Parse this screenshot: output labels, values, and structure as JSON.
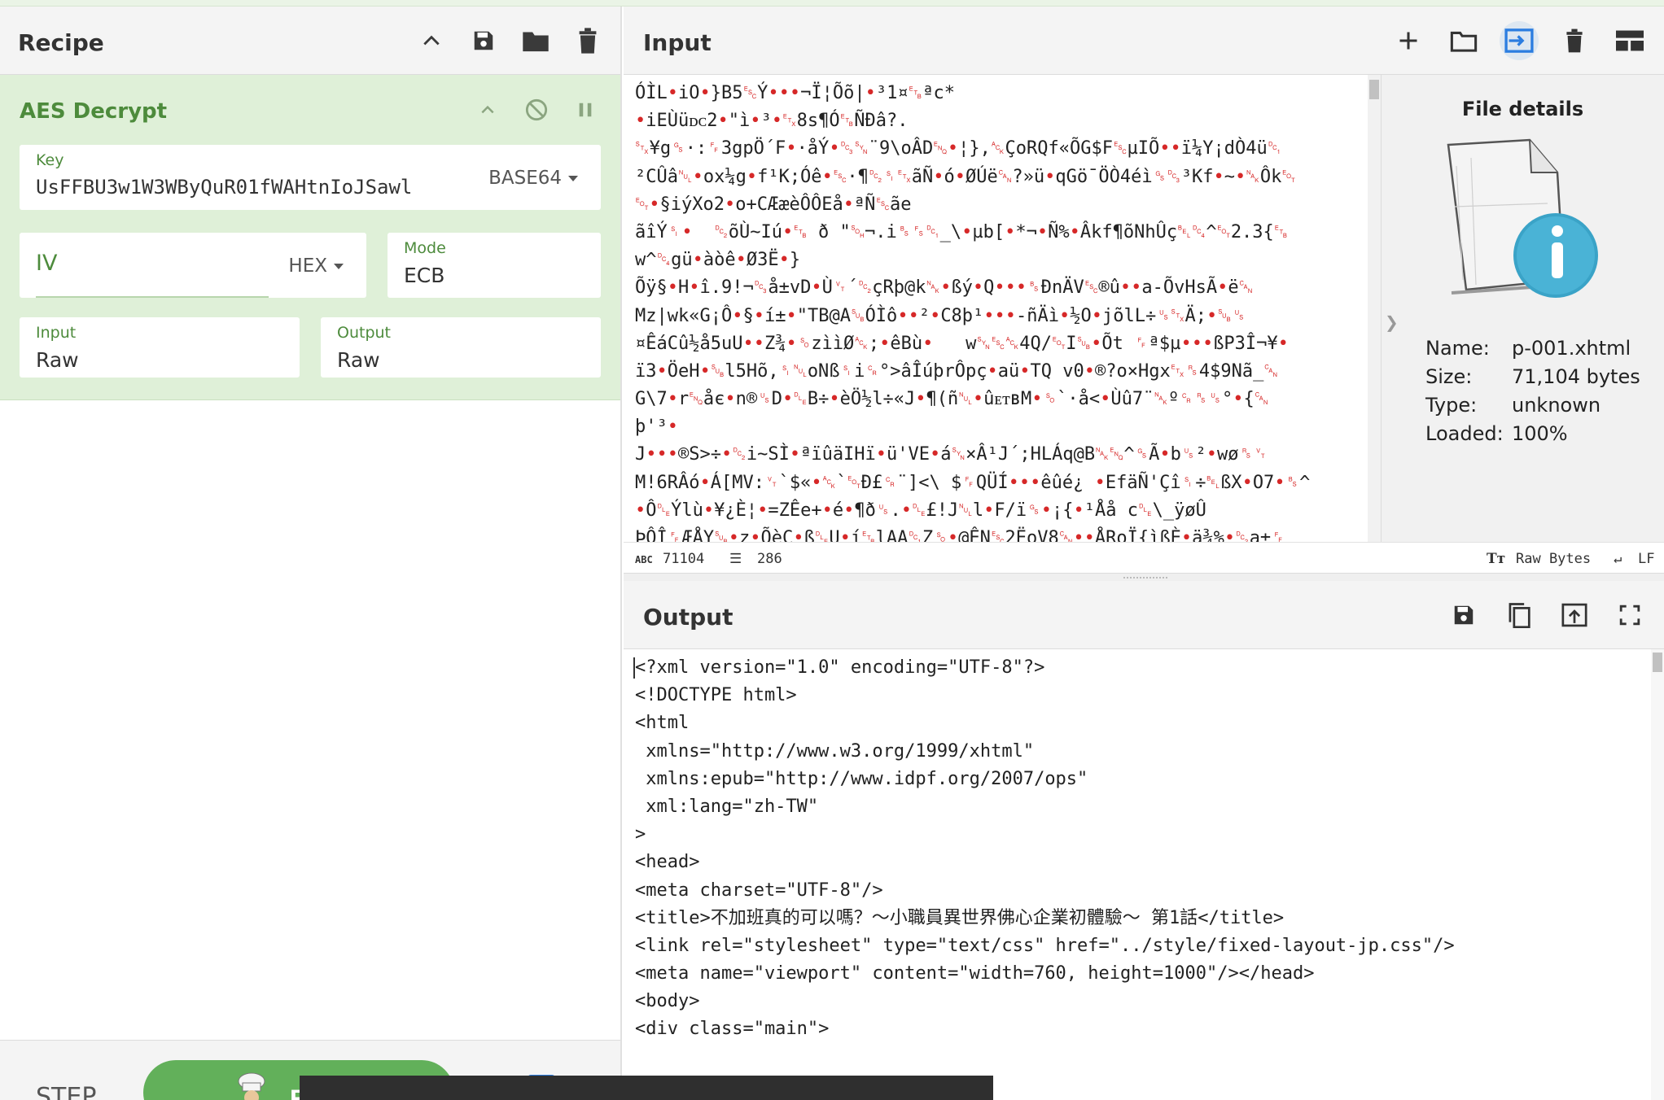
{
  "recipe": {
    "title": "Recipe",
    "operation": {
      "name": "AES Decrypt",
      "key": {
        "label": "Key",
        "value": "UsFFBU3w1W3WByQuR01fWAHtnIoJSawl",
        "format": "BASE64"
      },
      "iv": {
        "placeholder": "IV",
        "format": "HEX"
      },
      "mode": {
        "label": "Mode",
        "value": "ECB"
      },
      "input": {
        "label": "Input",
        "value": "Raw"
      },
      "output": {
        "label": "Output",
        "value": "Raw"
      }
    },
    "bottom": {
      "step_label": "STEP",
      "bake_label": "B"
    }
  },
  "input": {
    "title": "Input",
    "lines": [
      "ÓÌL•iO•}B5␛Ý•••¬Ï¦Õõ|•³1¤␗ªc*",
      "•iEÙüᴅᴄ2•\"ì•³•␃8s¶Ó␗ÑÐâ?.",
      "␂¥g␝·:␌3gpÖ´F•·åÝ•␓␖¨9\\oÂD␅•¦},␆ÇoRQf«ÕG$F␛µIÕ••ï¼Y¡dÒ4ü␑",
      "²CÛâ␀•ox¼g•f¹K;Óê•␛·¶␒␏␃ãÑ•ó•ØÚë␘?»ü•qGö¯ÖÒ4éì␝␓³Kf•~•␕Ôk␄",
      "␄•§iýXo2•o+CÆæèÔÔEå•ªÑ␛ãe",
      "ãîÝ␏•  ␒õÙ~Iú•␗ ð \"␁¬.i␈␜␑_\\•µb[•*¬•Ñ%•Âkf¶õNhÛç␇␔^␄2.3{␗",
      "w^␔gü•àòê•Ø3Ë•}",
      "Õÿ§•H•î.9!¬␓å±vD•Ù␋´␒çRþ@k␕•ßý•Q•••␈ÐnÄV␛®û••a-ÕvHsÃ•ë␘",
      "Mz|wk«G¡Ô•§•í±•\"TB@A␚ÓÌô••²•C8þ¹•••-ñÄì•½O•jõlL÷␟␂Ä;•␚␟",
      "¤ÊáCû½å5uU••Z¾•␎zììØ␆;•êBù•   w␖␛␆4Q/␄I␚•Õt ␌ª$µ•••ßP3Î¬¥•",
      "ï3•ÖeH•␚l5Hõ,␏␀oNß␏i␍°>âÎúþrÔpç•aü•TQ v0•®?o×Hgx␃␞4$9Nã_␘",
      "G\\7•r␅åє•n®␟D•␐B÷•èÖ½l÷«J•¶(ñ␀•ûᴇᴛʙM•␎`·å<•Ùû7¨␕º␍␞␟°•{␘",
      "þ'³•",
      "J•••®S>÷•␒i~SÌ•ªïûäIHï•ü'VE•á␖×Â¹J´;HLÁq@B␕␅^␝Ã•b␟²•wø␞␋",
      "M!6RÂó•Á[MV:␋`$«•␆`␄Ð£␍¨]<\\ $␌QÜÍ•••êûé¿ •EfäÑ'Çî␏÷␇ßX•O7•␈^",
      "•Ô␐Ýlù•¥¿È¦•=ZÊe+•é•¶ð␟.•␐£!J␀l•F/ï␝•¡{•¹Åå c␐\\_ÿøÛ",
      "ÞÔÎ␌ÆÅY␚•z•ÕèC•ß␐U•í␗lAA␑Z␎•@ÊN␛2ËoV8␘••ÅRoÏ{ìßÈ•ä¾%•␒a±␌"
    ],
    "status": {
      "chars": "71104",
      "lines": "286",
      "encoding": "Raw Bytes",
      "eol": "LF"
    }
  },
  "file_details": {
    "title": "File details",
    "rows": [
      {
        "k": "Name:",
        "v": "p-001.xhtml"
      },
      {
        "k": "Size:",
        "v": "71,104 bytes"
      },
      {
        "k": "Type:",
        "v": "unknown"
      },
      {
        "k": "Loaded:",
        "v": "100%"
      }
    ]
  },
  "output": {
    "title": "Output",
    "lines": [
      "<?xml version=\"1.0\" encoding=\"UTF-8\"?>",
      "<!DOCTYPE html>",
      "<html",
      " xmlns=\"http://www.w3.org/1999/xhtml\"",
      " xmlns:epub=\"http://www.idpf.org/2007/ops\"",
      " xml:lang=\"zh-TW\"",
      ">",
      "<head>",
      "<meta charset=\"UTF-8\"/>",
      "<title>不加班真的可以嗎？～小職員異世界佛心企業初體驗～ 第1話</title>",
      "<link rel=\"stylesheet\" type=\"text/css\" href=\"../style/fixed-layout-jp.css\"/>",
      "<meta name=\"viewport\" content=\"width=760, height=1000\"/></head>",
      "<body>",
      "<div class=\"main\">"
    ]
  }
}
